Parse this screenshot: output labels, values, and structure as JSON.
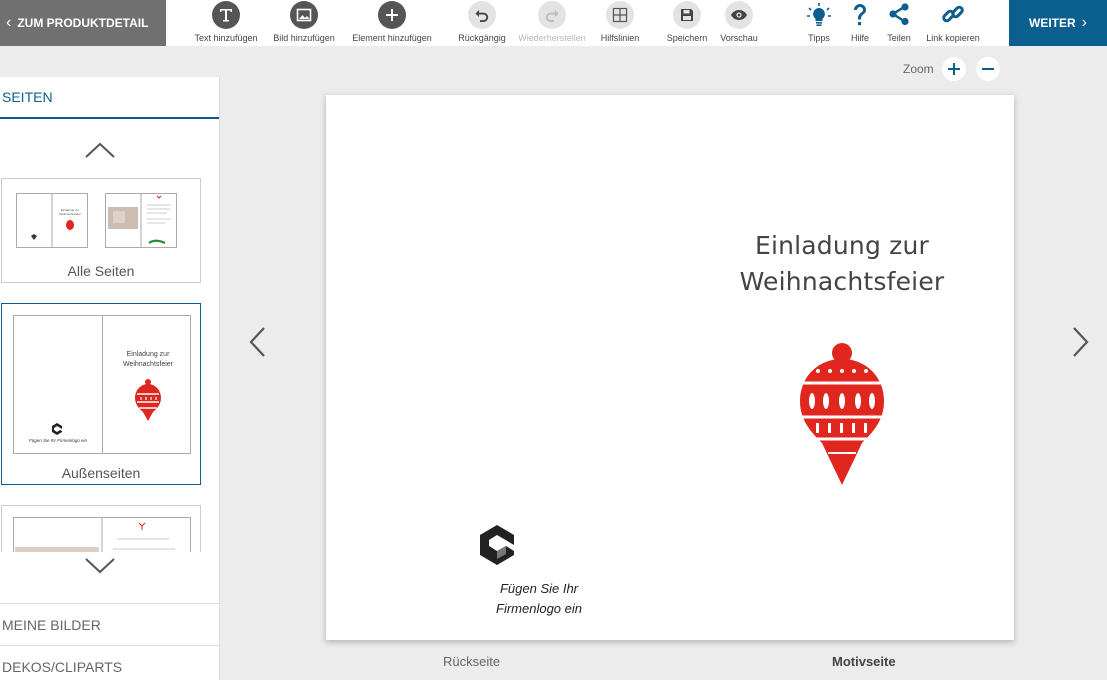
{
  "toolbar": {
    "back_label": "ZUM PRODUKTDETAIL",
    "next_label": "WEITER",
    "tools": {
      "text": "Text hinzufügen",
      "image": "Bild hinzufügen",
      "element": "Element hinzufügen",
      "undo": "Rückgängig",
      "redo": "Wiederherstellen",
      "guides": "Hilfslinien",
      "save": "Speichern",
      "preview": "Vorschau",
      "tips": "Tipps",
      "help": "Hilfe",
      "share": "Teilen",
      "copy_link": "Link kopieren"
    }
  },
  "sidebar": {
    "header": "SEITEN",
    "thumbs": [
      {
        "label": "Alle Seiten"
      },
      {
        "label": "Außenseiten",
        "title": "Einladung zur Weihnachtsfeier",
        "logo_text": "Fügen Sie Ihr Firmenlogo ein"
      }
    ],
    "sections": [
      "MEINE BILDER",
      "DEKOS/CLIPARTS"
    ]
  },
  "zoom": {
    "label": "Zoom"
  },
  "canvas": {
    "title_line1": "Einladung zur",
    "title_line2": "Weihnachtsfeier",
    "logo_line1": "Fügen Sie Ihr",
    "logo_line2": "Firmenlogo ein"
  },
  "pages": {
    "back": "Rückseite",
    "front": "Motivseite"
  },
  "colors": {
    "accent": "#0b5f8f",
    "ornament_red": "#e0261e",
    "back_button": "#707070"
  }
}
